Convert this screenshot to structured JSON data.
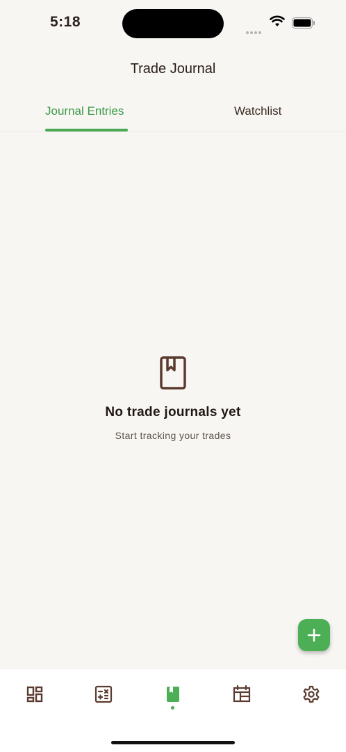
{
  "status": {
    "time": "5:18"
  },
  "header": {
    "title": "Trade Journal"
  },
  "tabs": [
    {
      "label": "Journal Entries",
      "active": true
    },
    {
      "label": "Watchlist",
      "active": false
    }
  ],
  "empty_state": {
    "icon": "bookmark-book-icon",
    "title": "No trade journals yet",
    "subtitle": "Start tracking your trades"
  },
  "fab": {
    "icon": "plus-icon"
  },
  "bottom_nav": [
    {
      "icon": "dashboard-icon",
      "active": false
    },
    {
      "icon": "calculator-icon",
      "active": false
    },
    {
      "icon": "journal-book-icon",
      "active": true
    },
    {
      "icon": "calendar-icon",
      "active": false
    },
    {
      "icon": "gear-icon",
      "active": false
    }
  ],
  "colors": {
    "accent": "#4cae55",
    "icon": "#5b3b30",
    "background": "#f8f6f2"
  }
}
